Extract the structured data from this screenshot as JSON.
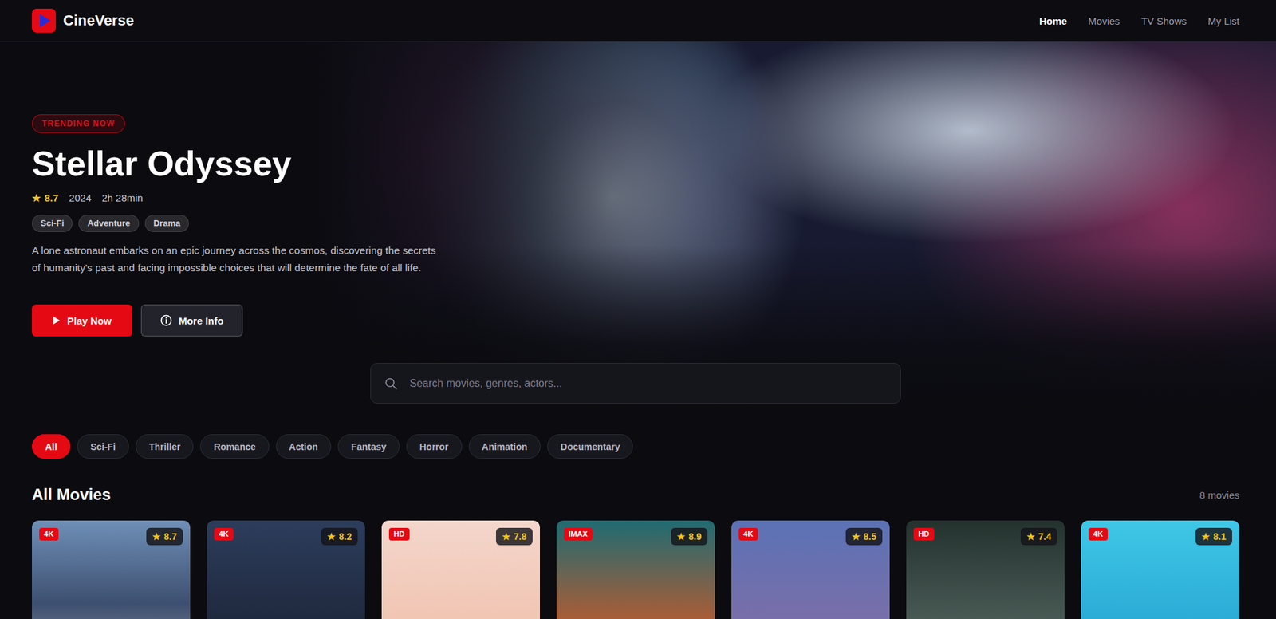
{
  "brand": {
    "name": "CineVerse"
  },
  "nav": [
    {
      "label": "Home",
      "selected": true
    },
    {
      "label": "Movies",
      "selected": false
    },
    {
      "label": "TV Shows",
      "selected": false
    },
    {
      "label": "My List",
      "selected": false
    }
  ],
  "hero": {
    "badge": "TRENDING NOW",
    "title": "Stellar Odyssey",
    "rating_icon": "★",
    "rating": "8.7",
    "year": "2024",
    "duration": "2h 28min",
    "tags": [
      "Sci-Fi",
      "Adventure",
      "Drama"
    ],
    "description": "A lone astronaut embarks on an epic journey across the cosmos, discovering the secrets of humanity's past and facing impossible choices that will determine the fate of all life.",
    "buttons": [
      {
        "label": "Play Now",
        "kind": "primary"
      },
      {
        "label": "More Info",
        "kind": "secondary"
      }
    ]
  },
  "search": {
    "placeholder": "Search movies, genres, actors..."
  },
  "genres": [
    {
      "label": "All",
      "selected": true
    },
    {
      "label": "Sci-Fi",
      "selected": false
    },
    {
      "label": "Thriller",
      "selected": false
    },
    {
      "label": "Romance",
      "selected": false
    },
    {
      "label": "Action",
      "selected": false
    },
    {
      "label": "Fantasy",
      "selected": false
    },
    {
      "label": "Horror",
      "selected": false
    },
    {
      "label": "Animation",
      "selected": false
    },
    {
      "label": "Documentary",
      "selected": false
    }
  ],
  "section": {
    "title": "All Movies",
    "count": "8 movies"
  },
  "movies": [
    {
      "quality": "4K",
      "star": "★",
      "rating": "8.7"
    },
    {
      "quality": "4K",
      "star": "★",
      "rating": "8.2"
    },
    {
      "quality": "HD",
      "star": "★",
      "rating": "7.8"
    },
    {
      "quality": "IMAX",
      "star": "★",
      "rating": "8.9"
    },
    {
      "quality": "4K",
      "star": "★",
      "rating": "8.5"
    },
    {
      "quality": "HD",
      "star": "★",
      "rating": "7.4"
    },
    {
      "quality": "4K",
      "star": "★",
      "rating": "8.1"
    }
  ]
}
